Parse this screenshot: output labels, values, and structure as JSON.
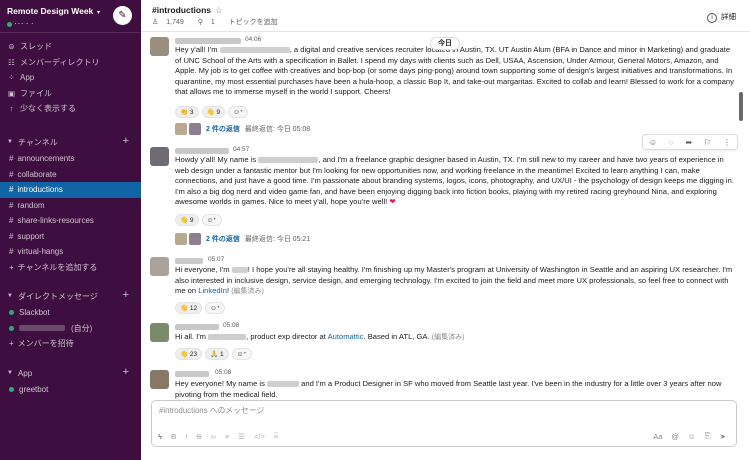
{
  "workspace": {
    "name": "Remote Design Week",
    "user_status": "･･･ ･ ･"
  },
  "sidebar": {
    "nav": [
      {
        "icon": "thread-icon",
        "glyph": "⊜",
        "label": "スレッド"
      },
      {
        "icon": "directory-icon",
        "glyph": "☷",
        "label": "メンバーディレクトリ"
      },
      {
        "icon": "apps-icon",
        "glyph": "⁘",
        "label": "App"
      },
      {
        "icon": "files-icon",
        "glyph": "▣",
        "label": "ファイル"
      },
      {
        "icon": "show-less-icon",
        "glyph": "↑",
        "label": "少なく表示する"
      }
    ],
    "channels_header": "チャンネル",
    "channels": [
      "announcements",
      "collaborate",
      "introductions",
      "random",
      "share-links-resources",
      "support",
      "virtual-hangs"
    ],
    "active_channel": "introductions",
    "add_channel": "チャンネルを追加する",
    "dm_header": "ダイレクトメッセージ",
    "dms": {
      "slackbot": "Slackbot",
      "self_suffix": "(自分)",
      "invite": "メンバーを招待"
    },
    "app_header": "App",
    "apps": [
      "greetbot"
    ]
  },
  "header": {
    "channel": "#introductions",
    "members": "1,749",
    "pins": "1",
    "add_topic": "トピックを追加",
    "details": "詳細"
  },
  "day_divider": "今日",
  "messages": [
    {
      "time": "04:06",
      "p1": "Hey y'all! I'm",
      "p2": ", a digital and creative services recruiter located in Austin, TX. UT Austin Alum (BFA in Dance and minor in Marketing) and graduate of UNC School of the Arts with a specification in Ballet. I spend my days with clients such as Dell, USAA, Ascension, Under Armour, General Motors, Amazon, and Apple. My job is to get coffee with creatives and bop-bop (or some days ping-pong) around town supporting some of design's largest initiatives and transformations. In quarantine, my most essential purchases have been a hula-hoop, a classic Bop It, and take-out margaritas. Excited to collab and learn! Blessed to work for a company that allows me to immerse myself in the world I support. Cheers!",
      "reactions": [
        {
          "emoji": "👏",
          "count": "3"
        },
        {
          "emoji": "👋",
          "count": "9"
        }
      ],
      "thread": {
        "count": "2 件の返信",
        "last": "最終返信: 今日 05:08"
      }
    },
    {
      "time": "04:57",
      "p1": "Howdy y'all! My name is",
      "p2": ", and I'm a freelance graphic designer based in Austin, TX. I'm still new to my career and have two years of experience in web design under a fantastic mentor but I'm looking for new opportunities now, and working freelance in the meantime! Excited to learn anything I can, make connections, and just have a good time. I'm passionate about branding systems, logos, icons, photography, and UX/UI - the psychology of design keeps me digging in. I'm also a big dog nerd and video game fan, and have been enjoying digging back into fiction books, playing with my retired racing greyhound Nina, and exploring awesome worlds in games. Nice to meet y'all, hope you're well!",
      "heart": "❤",
      "reactions": [
        {
          "emoji": "👋",
          "count": "9"
        }
      ],
      "thread": {
        "count": "2 件の返信",
        "last": "最終返信: 今日 05:21"
      }
    },
    {
      "time": "05:07",
      "p1": "Hi everyone, I'm",
      "p2": "! I hope you're all staying healthy. I'm finishing up my Master's program at University of Washington in Seattle and an aspiring UX researcher. I'm also interested in inclusive design, service design, and emerging technology. I'm excited to join the field and meet more UX professionals, so feel free to connect with me on",
      "link": "LinkedIn",
      "p3": "!",
      "edited": "(編集済み)",
      "reactions": [
        {
          "emoji": "👋",
          "count": "12"
        }
      ]
    },
    {
      "time": "05:08",
      "p1": "Hi all. I'm",
      "p2": ", product exp director at",
      "link": "Automattic",
      "p3": ". Based in ATL, GA.",
      "edited": "(編集済み)",
      "reactions": [
        {
          "emoji": "👋",
          "count": "23"
        },
        {
          "emoji": "🙏",
          "count": "1"
        }
      ]
    },
    {
      "time": "05:08",
      "p1": "Hey everyone! My name is",
      "p2": "and I'm a Product Designer in SF who moved from Seattle last year. I've been in the industry for a little over 3 years after now pivoting from the medical field."
    }
  ],
  "composer": {
    "placeholder": "#introductions へのメッセージ"
  },
  "colors": {
    "sidebar": "#3f0e40",
    "active": "#1164a3",
    "link": "#1264a3",
    "presence": "#2bac76"
  }
}
